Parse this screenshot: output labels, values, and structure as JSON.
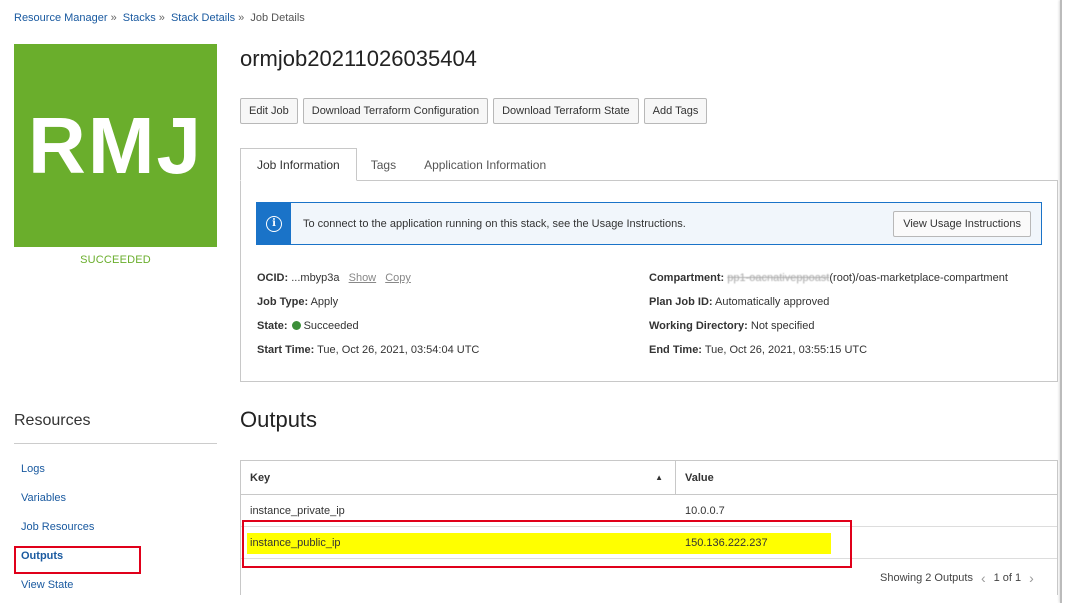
{
  "breadcrumb": {
    "items": [
      "Resource Manager",
      "Stacks",
      "Stack Details",
      "Job Details"
    ],
    "separator": "»"
  },
  "tile": {
    "initials": "RMJ",
    "status": "SUCCEEDED",
    "color": "#6aae2c"
  },
  "resources": {
    "title": "Resources",
    "items": [
      "Logs",
      "Variables",
      "Job Resources",
      "Outputs",
      "View State"
    ],
    "active": "Outputs"
  },
  "page": {
    "title": "ormjob20211026035404"
  },
  "toolbar": {
    "edit_job": "Edit Job",
    "download_config": "Download Terraform Configuration",
    "download_state": "Download Terraform State",
    "add_tags": "Add Tags"
  },
  "tabs": [
    "Job Information",
    "Tags",
    "Application Information"
  ],
  "info_banner": {
    "icon": "info-icon",
    "text": "To connect to the application running on this stack, see the Usage Instructions.",
    "button": "View Usage Instructions"
  },
  "job_info": {
    "ocid_label": "OCID:",
    "ocid_value": "...mbyp3a",
    "show_link": "Show",
    "copy_link": "Copy",
    "job_type_label": "Job Type:",
    "job_type_value": "Apply",
    "state_label": "State:",
    "state_value": "Succeeded",
    "start_label": "Start Time:",
    "start_value": "Tue, Oct 26, 2021, 03:54:04 UTC",
    "compartment_label": "Compartment:",
    "compartment_redacted": "pp1-oacnativeppoast",
    "compartment_value": "(root)/oas-marketplace-compartment",
    "plan_label": "Plan Job ID:",
    "plan_value": "Automatically approved",
    "workdir_label": "Working Directory:",
    "workdir_value": "Not specified",
    "end_label": "End Time:",
    "end_value": "Tue, Oct 26, 2021, 03:55:15 UTC"
  },
  "outputs": {
    "title": "Outputs",
    "columns": [
      "Key",
      "Value"
    ],
    "rows": [
      {
        "key": "instance_private_ip",
        "value": "10.0.0.7"
      },
      {
        "key": "instance_public_ip",
        "value": "150.136.222.237"
      }
    ],
    "footer_count": "Showing 2 Outputs",
    "page": "1 of 1"
  }
}
